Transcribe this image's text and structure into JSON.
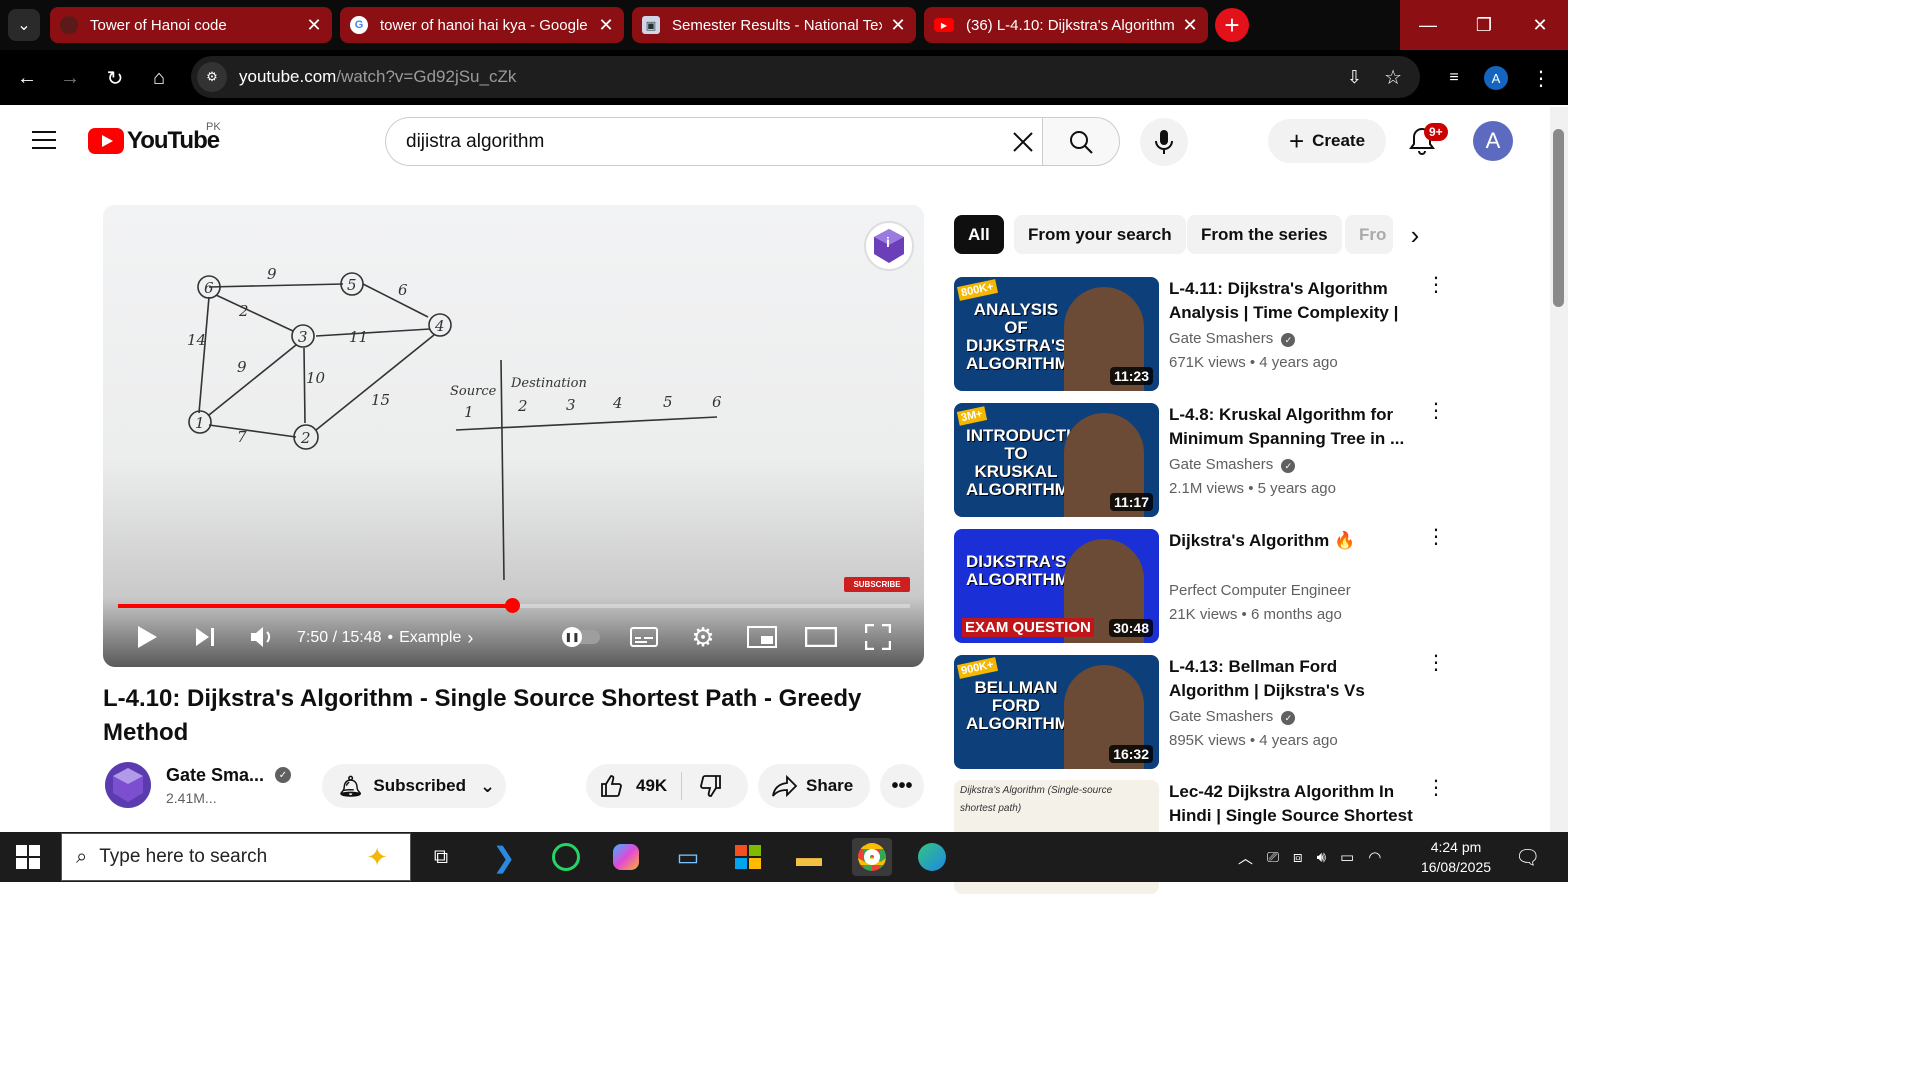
{
  "browser": {
    "tabs": [
      {
        "title": "Tower of Hanoi code",
        "icon": "code-site-icon"
      },
      {
        "title": "tower of hanoi hai kya - Google",
        "icon": "google-icon"
      },
      {
        "title": "Semester Results - National Tex",
        "icon": "university-icon"
      },
      {
        "title": "(36) L-4.10: Dijkstra's Algorithm",
        "icon": "youtube-icon"
      }
    ],
    "url_domain": "youtube.com",
    "url_path": "/watch?v=Gd92jSu_cZk",
    "profile_initial": "A"
  },
  "youtube": {
    "logo_text": "YouTube",
    "country": "PK",
    "search_value": "dijistra algorithm",
    "create_label": "Create",
    "notif_count": "9+",
    "avatar_initial": "A"
  },
  "player": {
    "time": "7:50 / 15:48",
    "chapter": "Example",
    "progress_fraction": 0.497,
    "subscribe_badge": "SUBSCRIBE"
  },
  "video": {
    "title": "L-4.10: Dijkstra's Algorithm - Single Source Shortest Path - Greedy Method",
    "channel": "Gate Sma...",
    "subscribers": "2.41M...",
    "subscribed_label": "Subscribed",
    "likes": "49K",
    "share_label": "Share"
  },
  "chips": [
    "All",
    "From your search",
    "From the series",
    "Fro"
  ],
  "recommendations": [
    {
      "title": "L-4.11: Dijkstra's Algorithm Analysis | Time Complexity | ...",
      "channel": "Gate Smashers",
      "verified": true,
      "meta": "671K views • 4 years ago",
      "duration": "11:23",
      "thumb_text": "ANALYSIS OF DIJKSTRA'S ALGORITHM",
      "thumb_badge": "800K+",
      "thumb_color": "#0d3f7a"
    },
    {
      "title": "L-4.8: Kruskal Algorithm for Minimum Spanning Tree in ...",
      "channel": "Gate Smashers",
      "verified": true,
      "meta": "2.1M views • 5 years ago",
      "duration": "11:17",
      "thumb_text": "INTRODUCTION TO KRUSKAL ALGORITHM",
      "thumb_badge": "3M+",
      "thumb_color": "#0d3f7a"
    },
    {
      "title": "Dijkstra's Algorithm 🔥",
      "channel": "Perfect Computer Engineer",
      "verified": false,
      "meta": "21K views • 6 months ago",
      "duration": "30:48",
      "thumb_text": "DIJKSTRA'S ALGORITHM",
      "thumb_badge": "EXAM QUESTION",
      "thumb_color": "#1a2fd6"
    },
    {
      "title": "L-4.13: Bellman Ford Algorithm | Dijkstra's Vs Bellman Ford | ...",
      "channel": "Gate Smashers",
      "verified": true,
      "meta": "895K views • 4 years ago",
      "duration": "16:32",
      "thumb_text": "BELLMAN FORD ALGORITHM",
      "thumb_badge": "900K+",
      "thumb_color": "#0d3f7a"
    },
    {
      "title": "Lec-42 Dijkstra Algorithm In Hindi | Single Source Shortest ...",
      "channel": "",
      "verified": false,
      "meta": "",
      "duration": "",
      "thumb_text": "Dijkstra's Algorithm (Single-source shortest path)",
      "thumb_badge": "",
      "thumb_color": "#f4f1e8"
    }
  ],
  "taskbar": {
    "search_placeholder": "Type here to search",
    "time": "4:24 pm",
    "date": "16/08/2025",
    "notification_count": "1"
  },
  "colors": {
    "accent": "#ff0000",
    "tab_bg": "#8b0f13",
    "chrome_bg": "#000000"
  }
}
